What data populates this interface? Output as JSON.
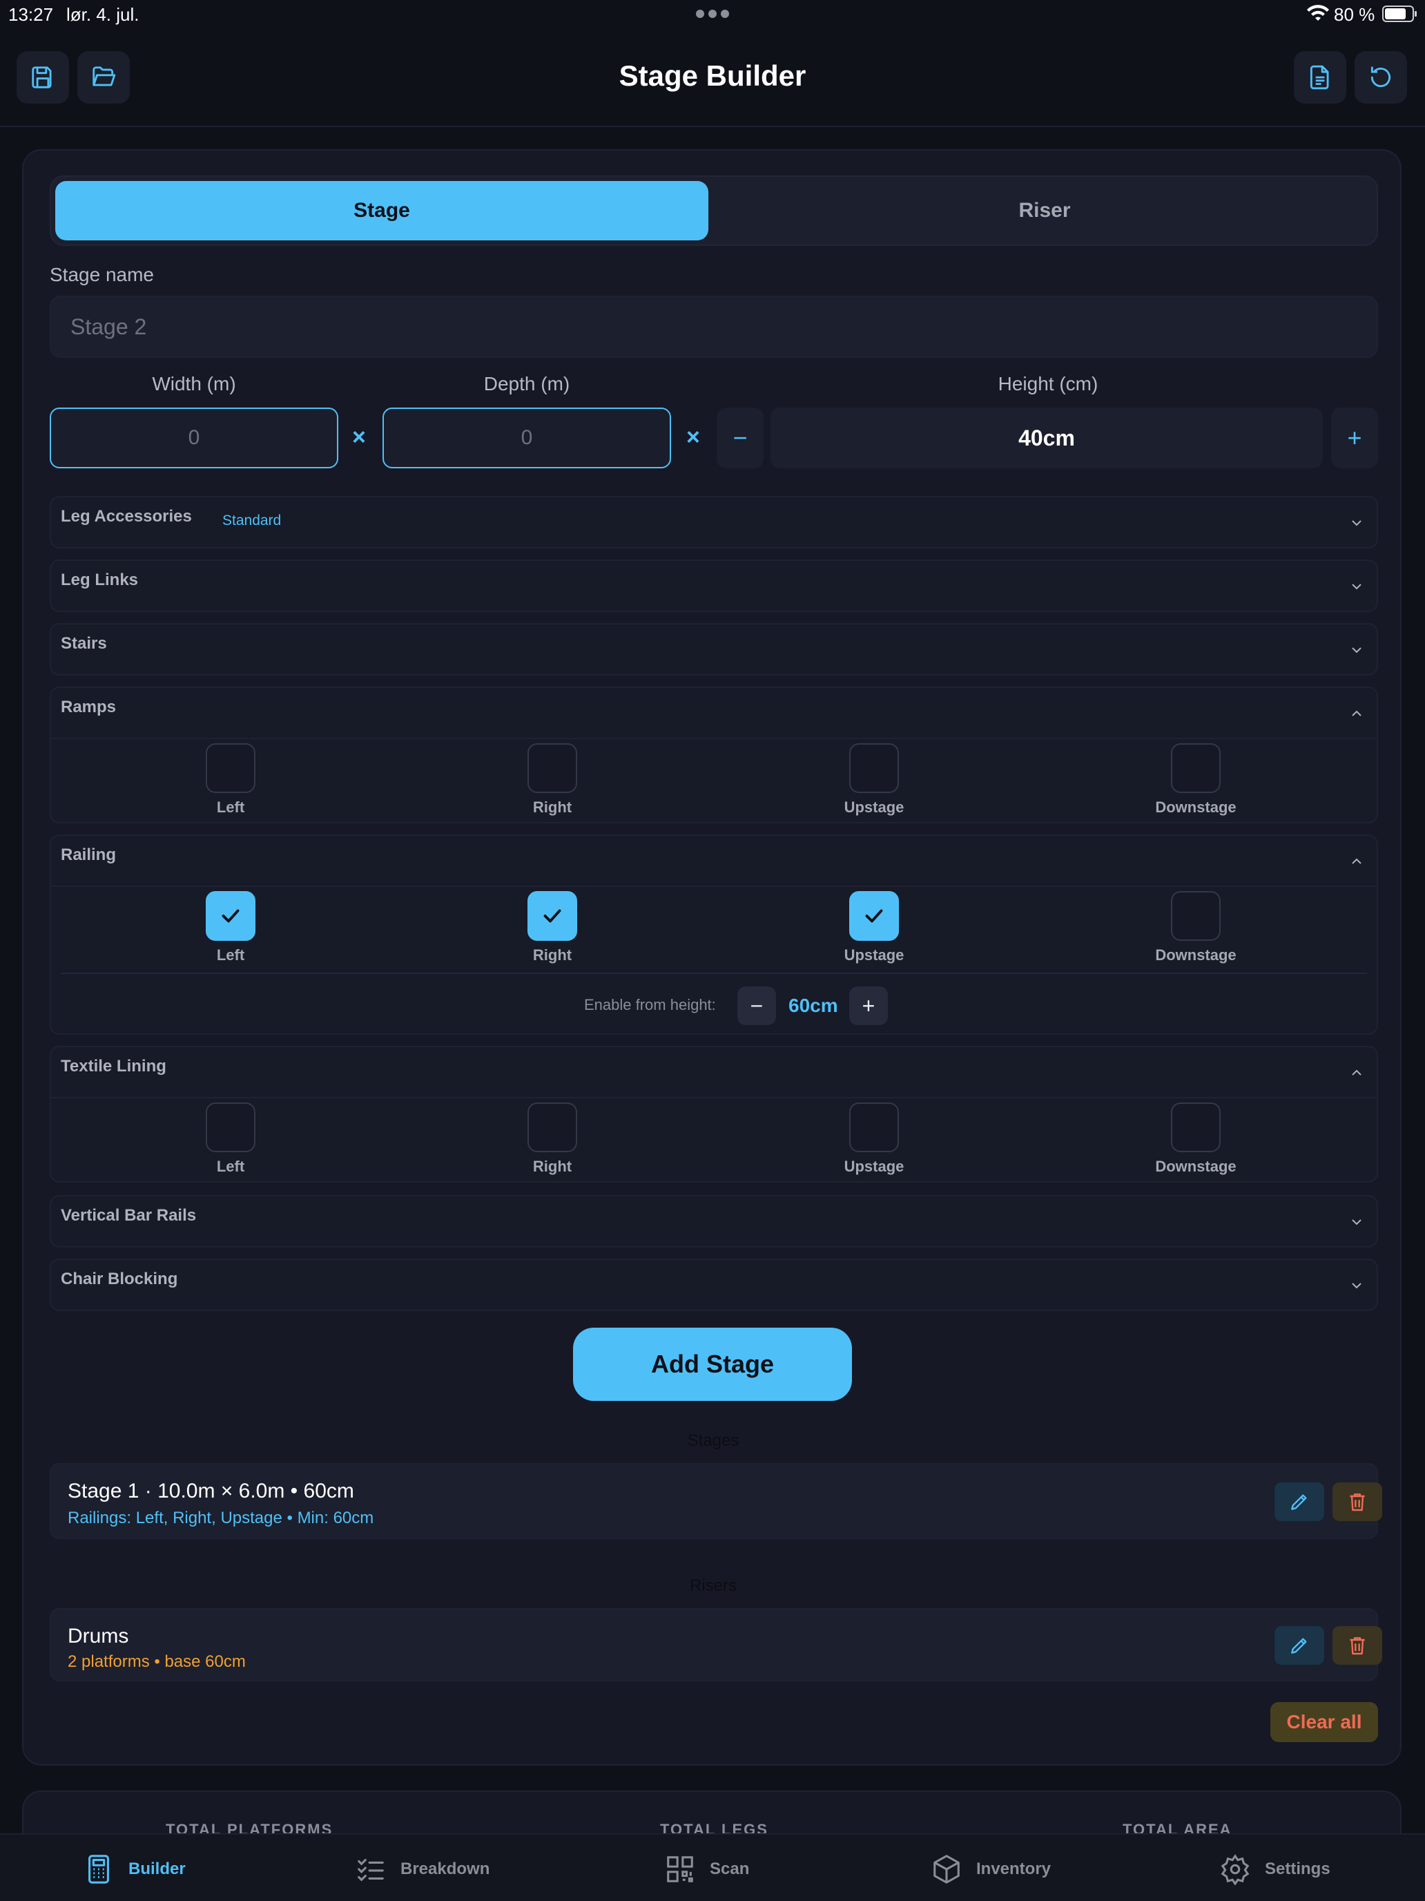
{
  "status": {
    "time": "13:27",
    "date": "lør. 4. jul.",
    "battery": "80 %"
  },
  "header": {
    "title": "Stage Builder",
    "icons": [
      "save-icon",
      "folder-open-icon",
      "document-icon",
      "refresh-icon"
    ]
  },
  "segment": {
    "tab_stage": "Stage",
    "tab_riser": "Riser",
    "active": "Stage"
  },
  "form": {
    "stage_name_label": "Stage name",
    "stage_name_placeholder": "Stage 2",
    "width_label": "Width (m)",
    "depth_label": "Depth (m)",
    "height_label": "Height (cm)",
    "width_value": "0",
    "depth_value": "0",
    "height_value": "40cm",
    "times": "×",
    "minus": "−",
    "plus": "+"
  },
  "accordions": {
    "leg_accessories": {
      "title": "Leg Accessories",
      "badge": "Standard"
    },
    "leg_links": {
      "title": "Leg Links"
    },
    "stairs": {
      "title": "Stairs"
    },
    "ramps": {
      "title": "Ramps"
    },
    "railing": {
      "title": "Railing",
      "enable_label": "Enable from height:",
      "enable_value": "60cm"
    },
    "textile_lining": {
      "title": "Textile Lining"
    },
    "vertical_bar_rails": {
      "title": "Vertical Bar Rails"
    },
    "chair_blocking": {
      "title": "Chair Blocking"
    }
  },
  "sides": {
    "left": "Left",
    "right": "Right",
    "upstage": "Upstage",
    "downstage": "Downstage"
  },
  "checked": {
    "ramps": [
      false,
      false,
      false,
      false
    ],
    "railing": [
      true,
      true,
      true,
      false
    ],
    "textile": [
      false,
      false,
      false,
      false
    ]
  },
  "add_button": "Add Stage",
  "stages": {
    "label": "Stages",
    "items": [
      {
        "title": "Stage 1 · 10.0m × 6.0m • 60cm",
        "sub": "Railings: Left, Right, Upstage • Min: 60cm"
      }
    ]
  },
  "risers": {
    "label": "Risers",
    "items": [
      {
        "title": "Drums",
        "sub": "2 platforms • base 60cm"
      }
    ]
  },
  "clear_all": "Clear all",
  "totals": {
    "platforms": "TOTAL PLATFORMS",
    "legs": "TOTAL LEGS",
    "area": "TOTAL AREA"
  },
  "tabbar": {
    "builder": "Builder",
    "breakdown": "Breakdown",
    "scan": "Scan",
    "inventory": "Inventory",
    "settings": "Settings",
    "active": "Builder"
  },
  "colors": {
    "accent": "#4fc0f7",
    "background": "#0f1119",
    "card": "#161826",
    "danger": "#f06b55",
    "riser_sub": "#f0a030"
  }
}
